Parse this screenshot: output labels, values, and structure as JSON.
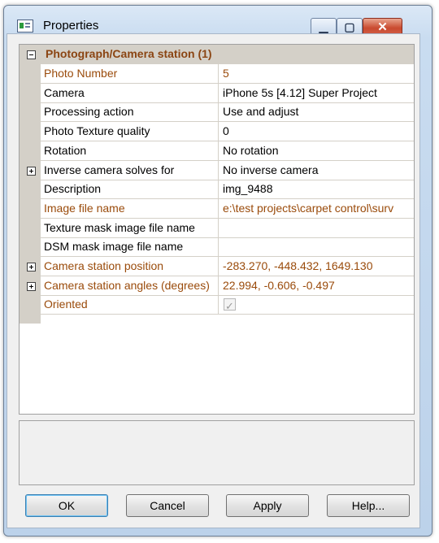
{
  "window": {
    "title": "Properties",
    "min_glyph": "▁",
    "max_glyph": "▢",
    "close_glyph": "✕"
  },
  "category": {
    "label": "Photograph/Camera station (1)",
    "expanded": true
  },
  "properties": [
    {
      "name": "Photo Number",
      "value": "5",
      "read_only": true,
      "expandable": false
    },
    {
      "name": "Camera",
      "value": "iPhone 5s [4.12] Super Project",
      "read_only": false,
      "expandable": false
    },
    {
      "name": "Processing action",
      "value": "Use and adjust",
      "read_only": false,
      "expandable": false
    },
    {
      "name": "Photo Texture quality",
      "value": "0",
      "read_only": false,
      "expandable": false
    },
    {
      "name": "Rotation",
      "value": "No rotation",
      "read_only": false,
      "expandable": false
    },
    {
      "name": "Inverse camera solves for",
      "value": "No inverse camera",
      "read_only": false,
      "expandable": true
    },
    {
      "name": "Description",
      "value": "img_9488",
      "read_only": false,
      "expandable": false
    },
    {
      "name": "Image file name",
      "value": "e:\\test projects\\carpet control\\surv",
      "read_only": true,
      "expandable": false
    },
    {
      "name": "Texture mask image file name",
      "value": "",
      "read_only": false,
      "expandable": false
    },
    {
      "name": "DSM mask image file name",
      "value": "",
      "read_only": false,
      "expandable": false
    },
    {
      "name": "Camera station position",
      "value": "-283.270, -448.432, 1649.130",
      "read_only": true,
      "expandable": true
    },
    {
      "name": "Camera station angles (degrees)",
      "value": "22.994, -0.606, -0.497",
      "read_only": true,
      "expandable": true
    },
    {
      "name": "Oriented",
      "value": "",
      "read_only": true,
      "expandable": false,
      "checkbox": true,
      "checked": true
    }
  ],
  "buttons": {
    "ok": "OK",
    "cancel": "Cancel",
    "apply": "Apply",
    "help": "Help..."
  },
  "icons": {
    "app": "properties-window-icon",
    "collapse": "minus-box-icon",
    "expand": "plus-box-icon",
    "check": "checkmark-icon"
  },
  "colors": {
    "category_text": "#8b4513",
    "readonly_text": "#9a4b0b",
    "gutter": "#d4d0c8",
    "close_button": "#c94a2f"
  }
}
